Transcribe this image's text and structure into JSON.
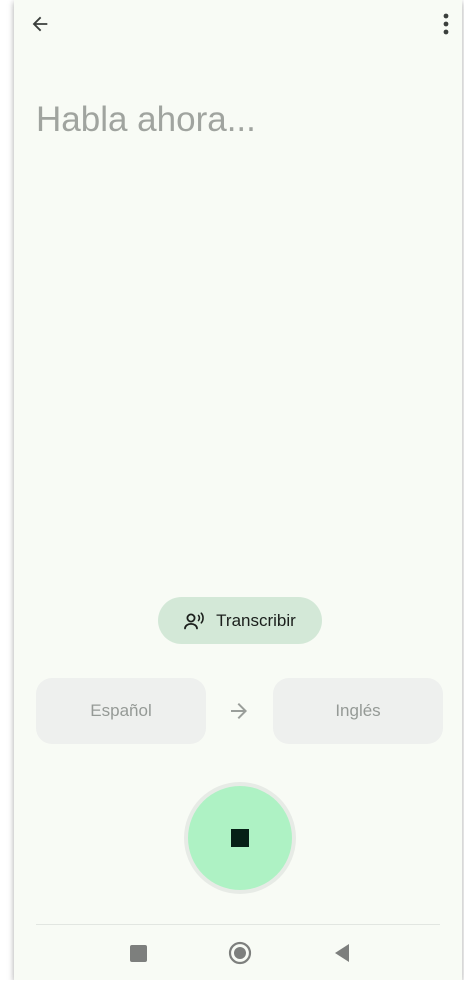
{
  "prompt": {
    "text": "Habla ahora..."
  },
  "transcribe": {
    "label": "Transcribir",
    "icon": "voice-person-icon",
    "bg": "#d3e8d7"
  },
  "languages": {
    "source": "Español",
    "target": "Inglés",
    "swap_icon": "arrow-right-icon"
  },
  "mic": {
    "state": "recording",
    "icon": "stop-icon",
    "color": "#aef2c4"
  },
  "top_bar": {
    "back_icon": "arrow-left-icon",
    "menu_icon": "more-vert-icon"
  },
  "nav_bar": {
    "items": [
      "recents-icon",
      "home-icon",
      "back-triangle-icon"
    ]
  }
}
